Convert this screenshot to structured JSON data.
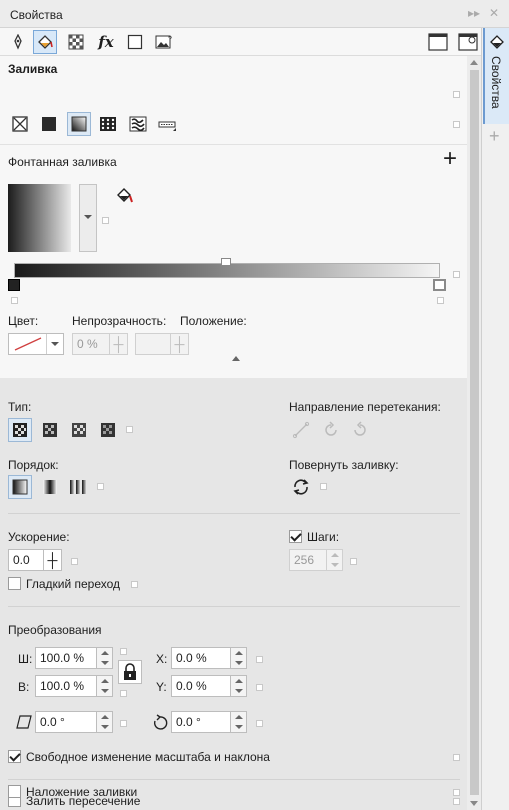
{
  "window": {
    "title": "Свойства",
    "expand_glyph": "▸▸",
    "close_glyph": "✕"
  },
  "tabs_vertical": {
    "properties_label": "Свойства",
    "add_glyph": "+"
  },
  "toolbar": {
    "icons": [
      "pen-outline-icon",
      "fill-bucket-icon",
      "transparency-icon",
      "effects-fx-icon",
      "frame-icon",
      "image-icon",
      "panel-view-icon",
      "panel-view-eye-icon"
    ],
    "fx_label": "fx"
  },
  "fill": {
    "section_title": "Заливка",
    "fill_types": [
      "no-fill-icon",
      "uniform-fill-icon",
      "fountain-fill-icon",
      "pattern-fill-icon",
      "texture-fill-icon",
      "postscript-fill-icon"
    ],
    "fountain_title": "Фонтанная заливка",
    "add_glyph": "+",
    "color_label": "Цвет:",
    "opacity_label": "Непрозрачность:",
    "opacity_value": "0 %",
    "position_label": "Положение:",
    "position_value": ""
  },
  "type_group": {
    "type_label": "Тип:",
    "types": [
      "linear-gradient-icon",
      "elliptical-gradient-icon",
      "conical-gradient-icon",
      "rectangular-gradient-icon"
    ],
    "blend_direction_label": "Направление перетекания:",
    "order_label": "Порядок:",
    "rotate_fill_label": "Повернуть заливку:"
  },
  "acceleration": {
    "label": "Ускорение:",
    "value": "0.0",
    "steps_label": "Шаги:",
    "steps_value": "256",
    "smooth_label": "Гладкий переход"
  },
  "transforms": {
    "title": "Преобразования",
    "w_label": "Ш:",
    "w_value": "100.0 %",
    "h_label": "В:",
    "h_value": "100.0 %",
    "x_label": "X:",
    "x_value": "0.0 %",
    "y_label": "Y:",
    "y_value": "0.0 %",
    "skew_value": "0.0 °",
    "rotate_value": "0.0 °",
    "free_scale_label": "Свободное изменение масштаба и наклона"
  },
  "bottom": {
    "fill_intersection_label": "Залить пересечение",
    "overprint_fill_label": "Наложение заливки"
  }
}
